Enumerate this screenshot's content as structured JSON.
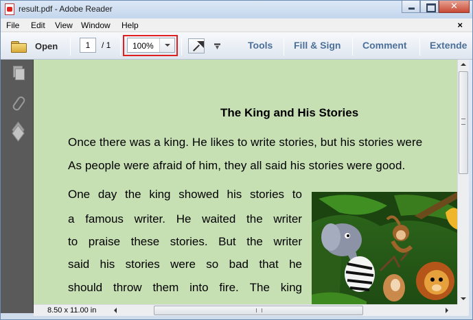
{
  "window": {
    "title": "result.pdf - Adobe Reader",
    "close_glyph": "✕"
  },
  "menu": {
    "items": [
      "File",
      "Edit",
      "View",
      "Window",
      "Help"
    ],
    "close_glyph": "×"
  },
  "toolbar": {
    "open_label": "Open",
    "current_page": "1",
    "page_total": "/ 1",
    "zoom": "100%",
    "links": [
      "Tools",
      "Fill & Sign",
      "Comment",
      "Extende"
    ]
  },
  "document": {
    "title": "The King and His Stories",
    "paragraph1": [
      "Once there was a king. He likes to write stories, but his stories were",
      "As people were afraid of him, they all said his stories were good."
    ],
    "paragraph2": [
      [
        "One",
        "day",
        "the",
        "king",
        "showed",
        "his",
        "stories",
        "to"
      ],
      [
        "a",
        "famous",
        "writer.",
        "He",
        "waited",
        "the",
        "writer"
      ],
      [
        "to",
        "praise",
        "these",
        "stories.",
        "But",
        "the",
        "writer"
      ],
      [
        "said",
        "his",
        "stories",
        "were",
        "so",
        "bad",
        "that",
        "he"
      ],
      [
        "should",
        "throw",
        "them",
        "into",
        "fire.",
        "The",
        "king"
      ]
    ],
    "image": "jungle-animals-illustration"
  },
  "status": {
    "page_size": "8.50 x 11.00 in"
  },
  "colors": {
    "page_background": "#c6e0b3",
    "link_color": "#4c6f99",
    "highlight": "#e01e1e"
  }
}
